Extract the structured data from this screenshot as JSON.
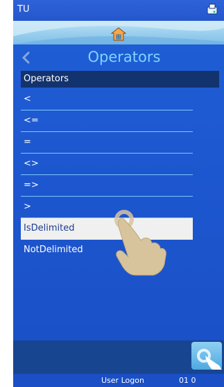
{
  "status_bar": {
    "title": "TU",
    "icon": "printer-status-icon"
  },
  "home": {
    "icon": "home-icon"
  },
  "header": {
    "title": "Operators",
    "back_icon": "chevron-left-icon"
  },
  "list": {
    "header": "Operators",
    "items": [
      {
        "label": "<"
      },
      {
        "label": "<="
      },
      {
        "label": "="
      },
      {
        "label": "<>"
      },
      {
        "label": "=>"
      },
      {
        "label": ">"
      },
      {
        "label": "IsDelimited",
        "selected": true
      },
      {
        "label": "NotDelimited"
      }
    ]
  },
  "footer": {
    "user": "User Logon",
    "time": "01 0"
  },
  "colors": {
    "background": "#1d57cf",
    "title": "#7fd3ff",
    "header": "#13336f",
    "divider": "#7cc8ff"
  }
}
